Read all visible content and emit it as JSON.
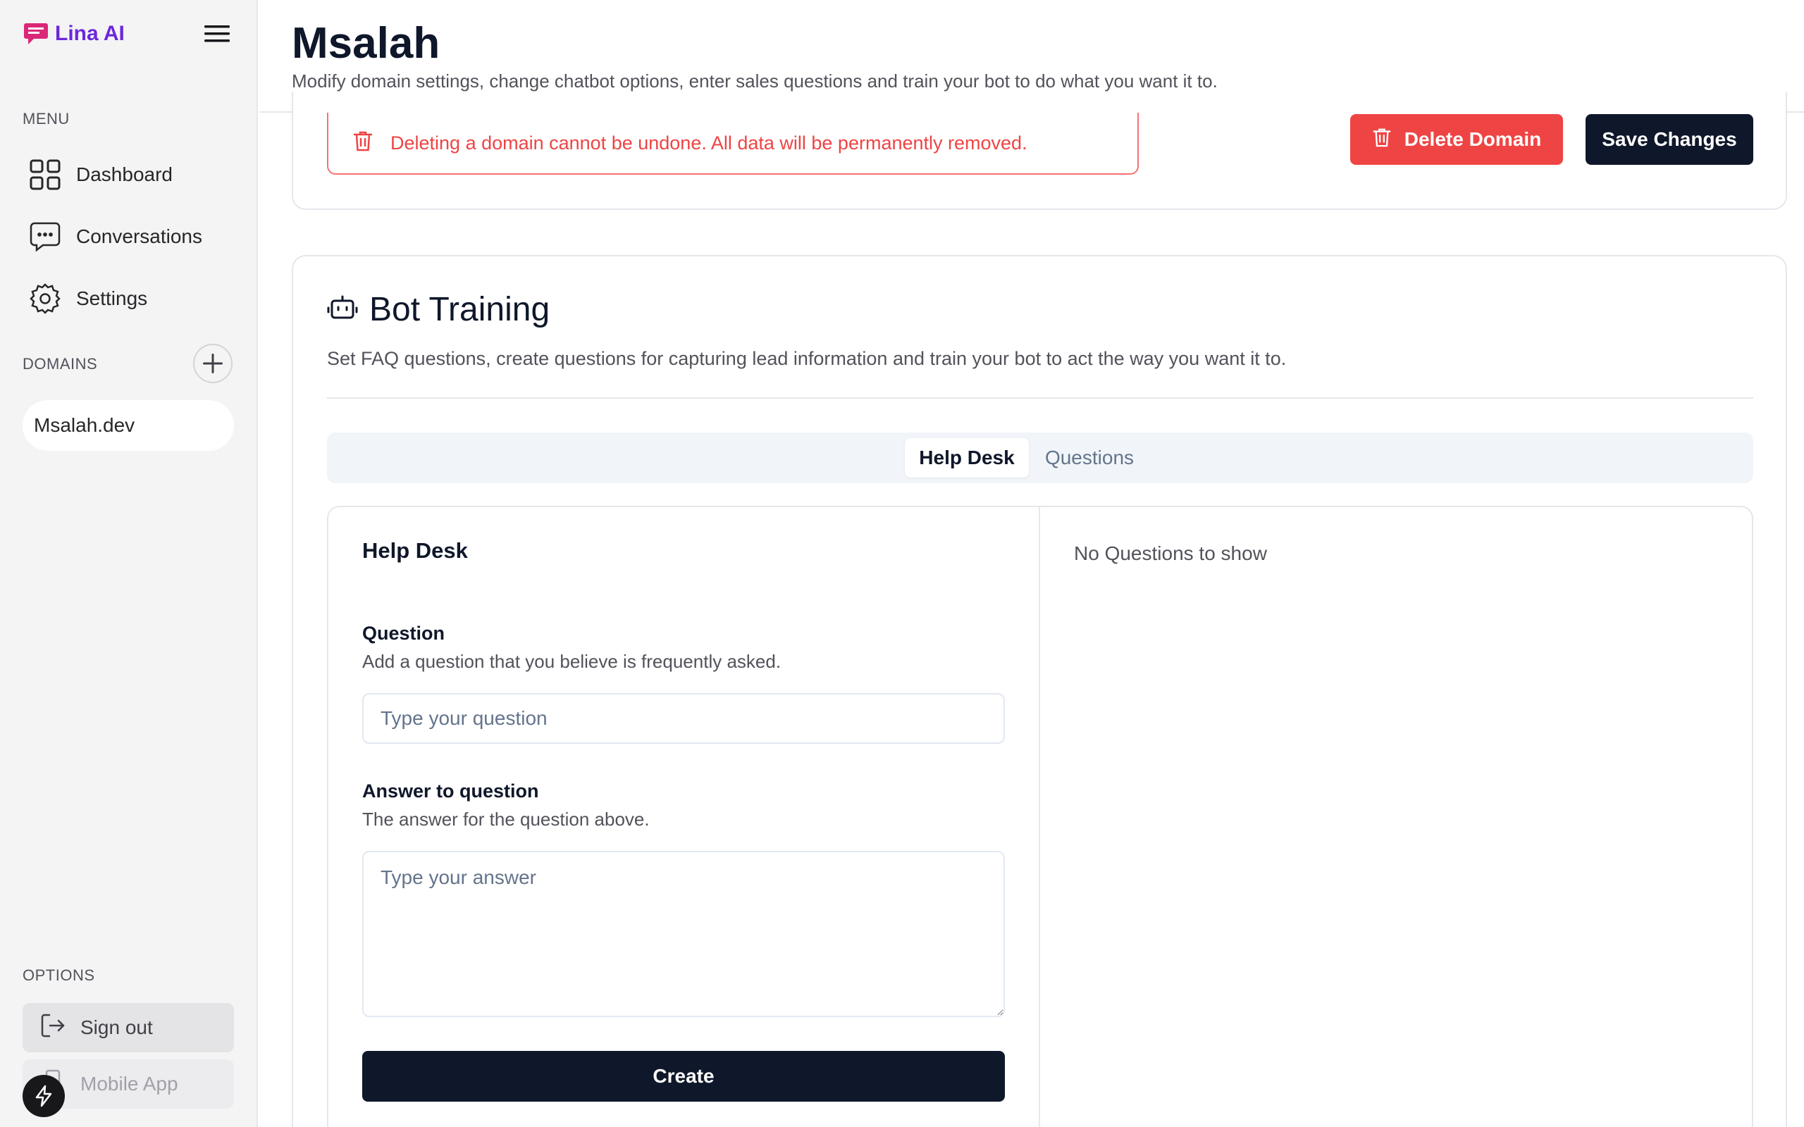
{
  "sidebar": {
    "brand": "Lina AI",
    "menu_label": "MENU",
    "menu_items": [
      {
        "label": "Dashboard",
        "icon": "grid-icon"
      },
      {
        "label": "Conversations",
        "icon": "chat-icon"
      },
      {
        "label": "Settings",
        "icon": "gear-icon"
      }
    ],
    "domains_label": "DOMAINS",
    "domains": [
      "Msalah.dev"
    ],
    "options_label": "OPTIONS",
    "options": [
      {
        "label": "Sign out",
        "icon": "sign-out-icon"
      },
      {
        "label": "Mobile App",
        "icon": "mobile-icon"
      }
    ]
  },
  "header": {
    "title": "Msalah",
    "subtitle": "Modify domain settings, change chatbot options, enter sales questions and train your bot to do what you want it to."
  },
  "danger": {
    "warning": "Deleting a domain cannot be undone. All data will be permanently removed.",
    "delete_label": "Delete Domain",
    "save_label": "Save Changes"
  },
  "training": {
    "title": "Bot Training",
    "description": "Set FAQ questions, create questions for capturing lead information and train your bot to act the way you want it to.",
    "tabs": [
      {
        "label": "Help Desk",
        "active": true
      },
      {
        "label": "Questions",
        "active": false
      }
    ],
    "form": {
      "heading": "Help Desk",
      "question_label": "Question",
      "question_help": "Add a question that you believe is frequently asked.",
      "question_placeholder": "Type your question",
      "question_value": "",
      "answer_label": "Answer to question",
      "answer_help": "The answer for the question above.",
      "answer_placeholder": "Type your answer",
      "answer_value": "",
      "create_label": "Create"
    },
    "empty_state": "No Questions to show"
  },
  "colors": {
    "brand": "#6d28d9",
    "brand_accent": "#db2777",
    "danger": "#ef4444",
    "primary": "#0f172a",
    "sidebar_bg": "#f4f4f5"
  }
}
